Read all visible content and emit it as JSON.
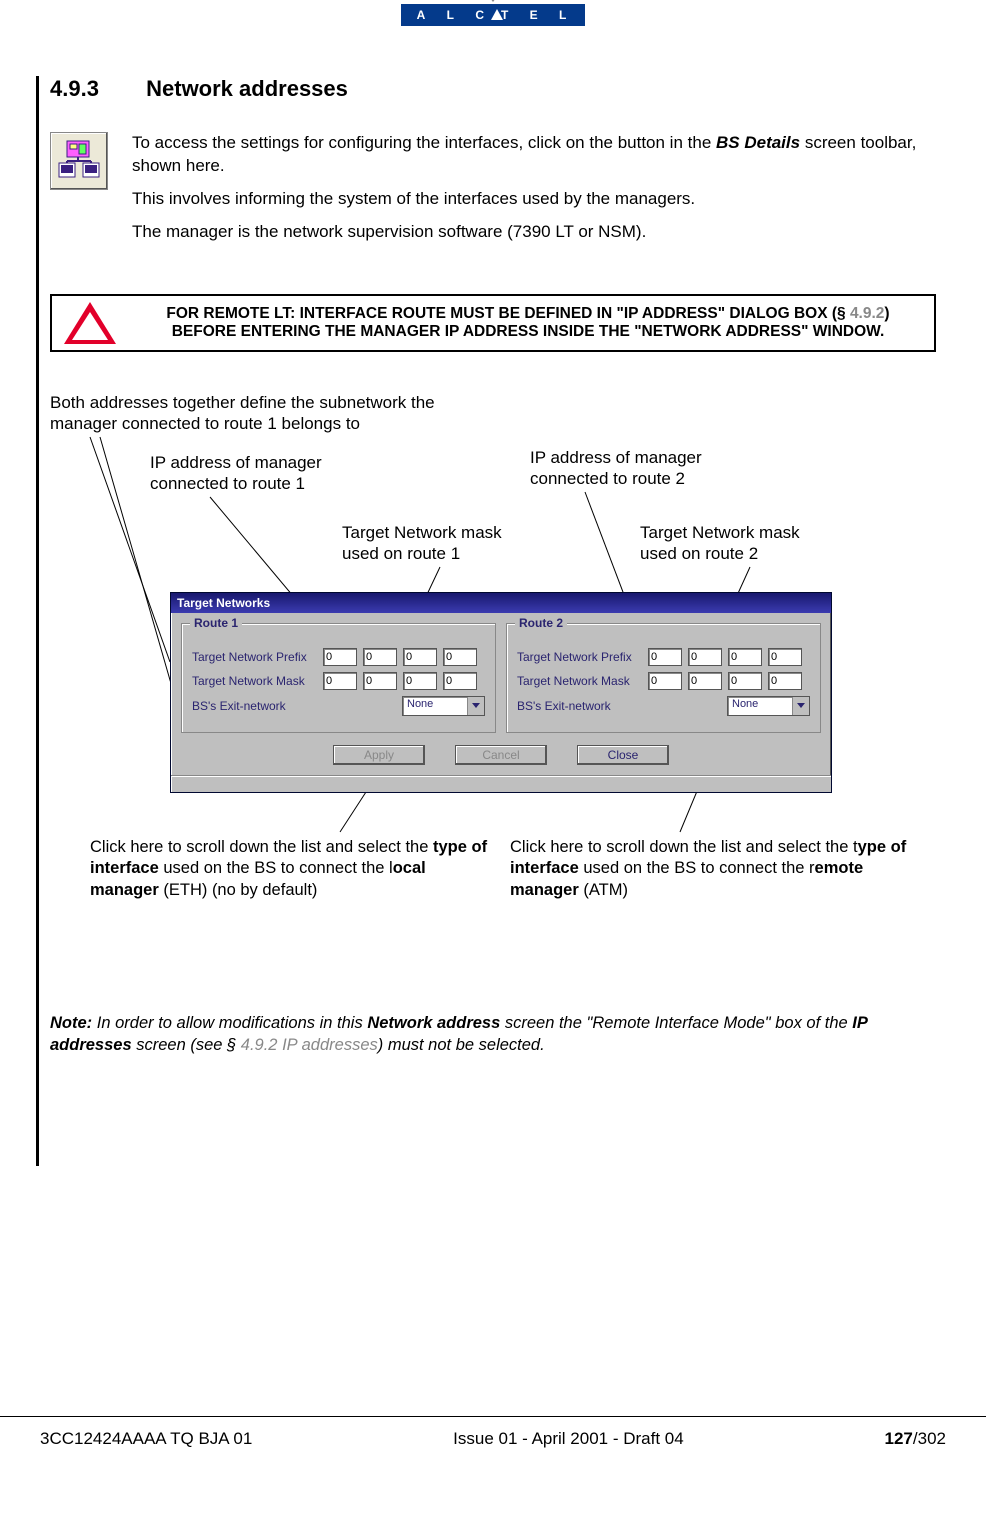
{
  "logo": "ALCATEL",
  "section_number": "4.9.3",
  "section_title": "Network addresses",
  "intro": {
    "p1a": "To access the settings for configuring the interfaces, click on the button in the ",
    "p1b": "BS Details",
    "p1c": " screen toolbar, shown here.",
    "p2": "This involves informing the system of the interfaces used by the managers.",
    "p3": "The manager is the network supervision software (7390 LT or NSM)."
  },
  "warning": {
    "line1a": "FOR REMOTE LT: INTERFACE ROUTE MUST BE DEFINED IN \"IP ADDRESS\" DIALOG BOX (§ ",
    "link": "4.9.2",
    "line1b": ") BEFORE ENTERING THE MANAGER IP ADDRESS INSIDE THE \"NETWORK ADDRESS\" WINDOW."
  },
  "annotations": {
    "a1": "Both addresses together define the subnetwork the manager connected to route 1 belongs to",
    "a2": "IP address of manager connected to route 1",
    "a3": "IP address of manager connected to route 2",
    "a4": "Target Network mask used on route 1",
    "a5": "Target Network mask used on route 2",
    "c1a": "Click here to scroll down the list and select the ",
    "c1b": "type of interface",
    "c1c": " used on the BS to connect the l",
    "c1d": "ocal manager",
    "c1e": " (ETH) (no by default)",
    "c2a": "Click here to scroll down the list and select the t",
    "c2b": "ype of interface",
    "c2c": " used on the BS to connect the r",
    "c2d": "emote manager",
    "c2e": " (ATM)"
  },
  "dialog": {
    "title": "Target Networks",
    "route1": {
      "title": "Route 1",
      "r1_label": "Target Network Prefix",
      "r1_v": [
        "0",
        "0",
        "0",
        "0"
      ],
      "r2_label": "Target Network Mask",
      "r2_v": [
        "0",
        "0",
        "0",
        "0"
      ],
      "r3_label": "BS's Exit-network",
      "r3_sel": "None"
    },
    "route2": {
      "title": "Route 2",
      "r1_label": "Target Network Prefix",
      "r1_v": [
        "0",
        "0",
        "0",
        "0"
      ],
      "r2_label": "Target Network Mask",
      "r2_v": [
        "0",
        "0",
        "0",
        "0"
      ],
      "r3_label": "BS's Exit-network",
      "r3_sel": "None"
    },
    "btn_apply": "Apply",
    "btn_cancel": "Cancel",
    "btn_close": "Close"
  },
  "note": {
    "lead": "Note:",
    "t1": " In order to allow modifications in this ",
    "b1": "Network address",
    "t2": " screen the \"Remote Interface Mode\" box of the ",
    "b2": "IP addresses",
    "t3": " screen (see § ",
    "link": "4.9.2 IP addresses",
    "t4": ") must not be selected."
  },
  "footer": {
    "left": "3CC12424AAAA TQ BJA 01",
    "center": "Issue 01 - April 2001 - Draft 04",
    "page_bold": "127",
    "page_tail": "/302"
  }
}
